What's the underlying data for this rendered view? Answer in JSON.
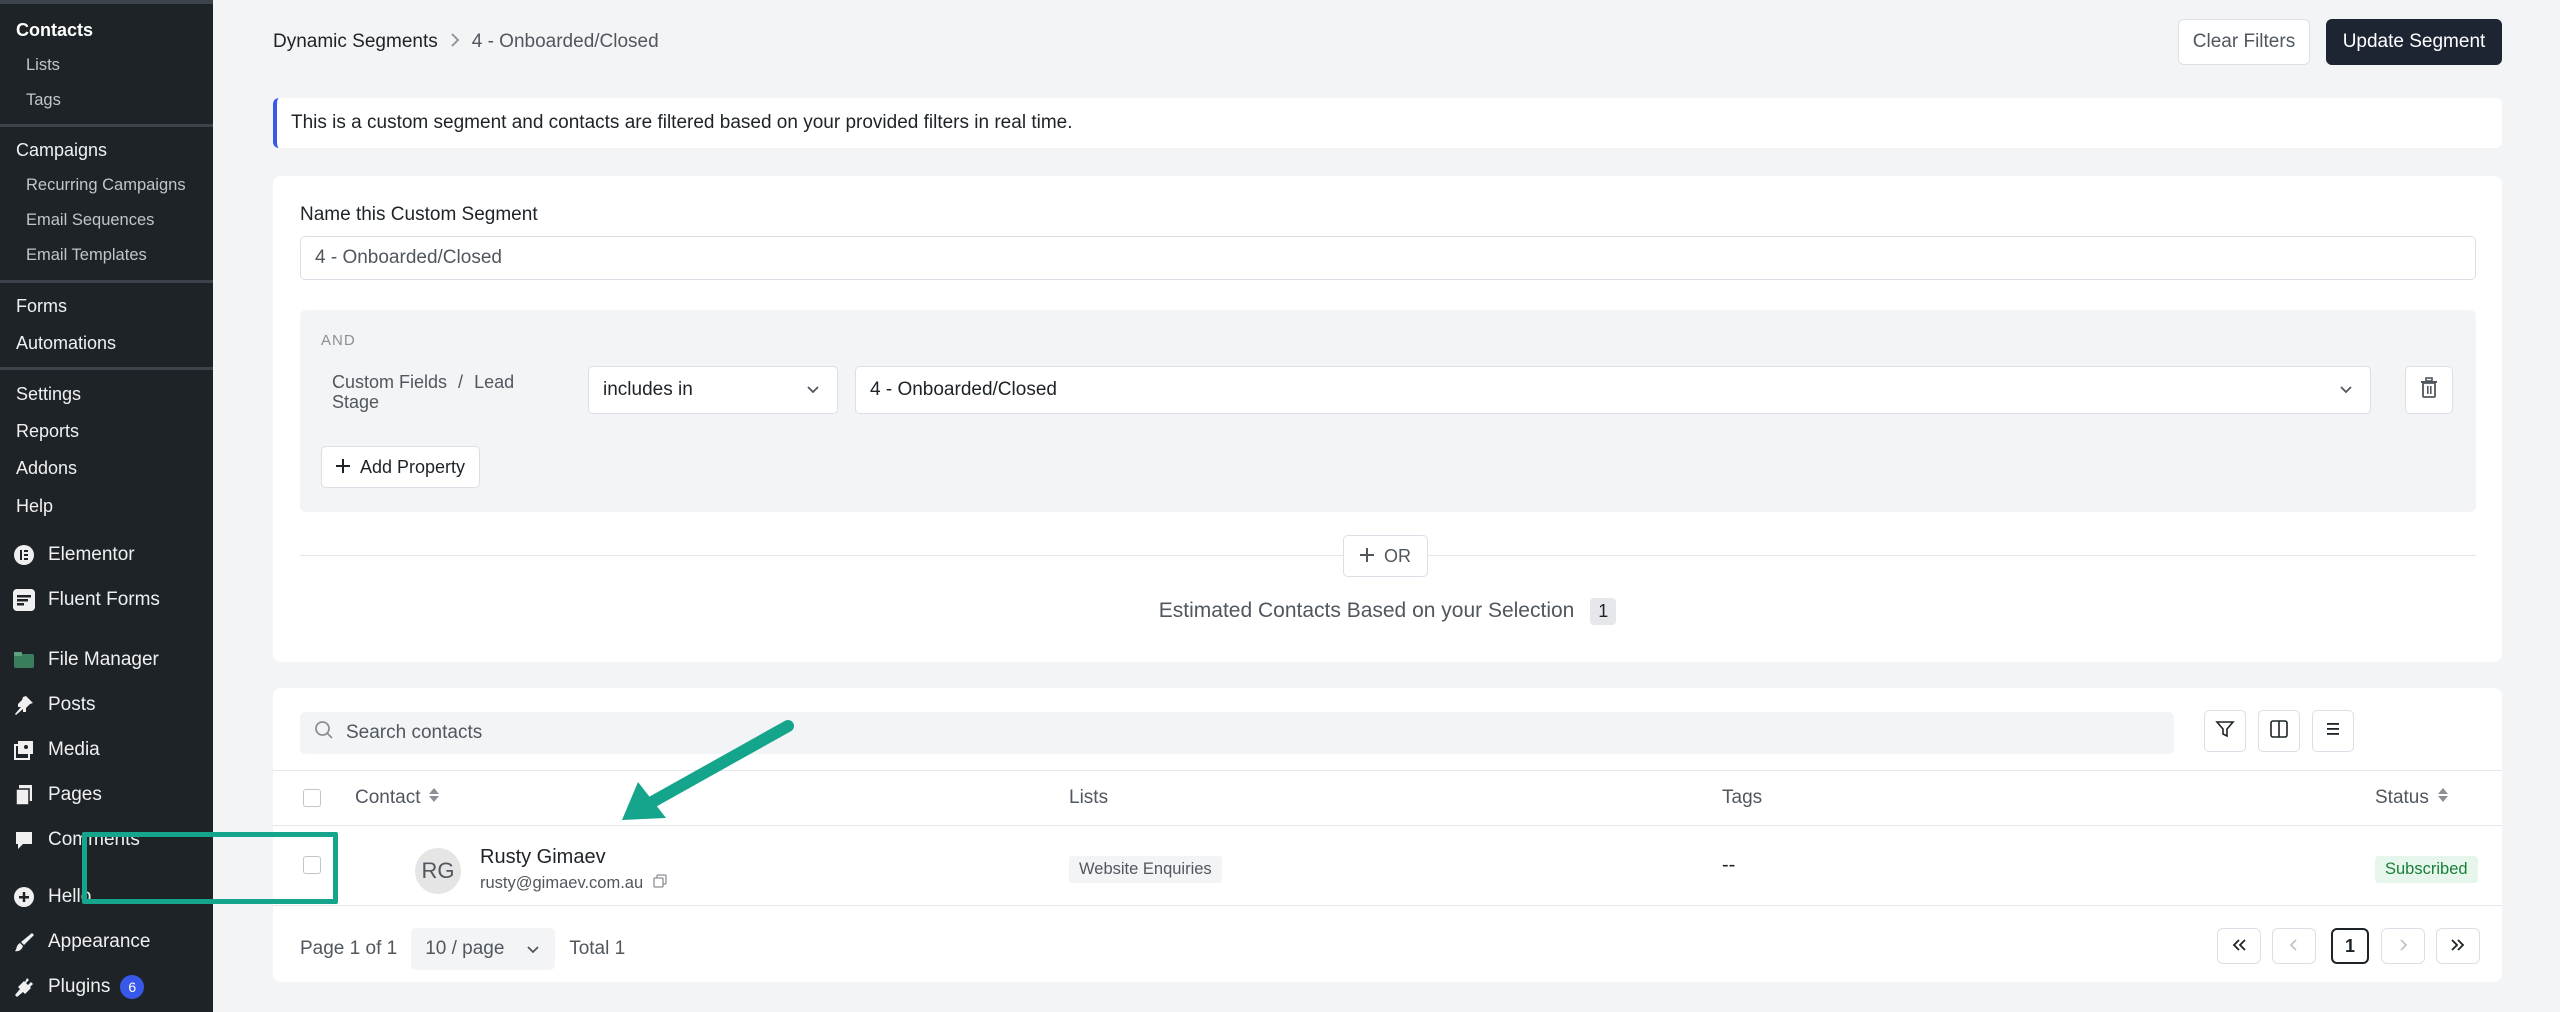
{
  "sidebar": {
    "contacts": "Contacts",
    "lists": "Lists",
    "tags": "Tags",
    "campaigns": "Campaigns",
    "recurring": "Recurring Campaigns",
    "sequences": "Email Sequences",
    "templates": "Email Templates",
    "forms": "Forms",
    "automations": "Automations",
    "settings": "Settings",
    "reports": "Reports",
    "addons": "Addons",
    "help": "Help",
    "main_items": [
      {
        "label": "Elementor",
        "icon": "elementor-icon"
      },
      {
        "label": "Fluent Forms",
        "icon": "fluent-forms-icon"
      },
      {
        "label": "File Manager",
        "icon": "file-manager-icon"
      },
      {
        "label": "Posts",
        "icon": "pin-icon"
      },
      {
        "label": "Media",
        "icon": "media-icon"
      },
      {
        "label": "Pages",
        "icon": "pages-icon"
      },
      {
        "label": "Comments",
        "icon": "comment-icon"
      },
      {
        "label": "Hello",
        "icon": "plus-circle-icon"
      },
      {
        "label": "Appearance",
        "icon": "brush-icon"
      },
      {
        "label": "Plugins",
        "icon": "plug-icon"
      }
    ],
    "plugins_badge": "6"
  },
  "header": {
    "breadcrumb_root": "Dynamic Segments",
    "breadcrumb_current": "4 - Onboarded/Closed",
    "clear_filters": "Clear Filters",
    "update_segment": "Update Segment"
  },
  "notice": "This is a custom segment and contacts are filtered based on your provided filters in real time.",
  "segment": {
    "name_label": "Name this Custom Segment",
    "name_value": "4 - Onboarded/Closed",
    "and_label": "AND",
    "field_path": "Custom Fields",
    "field_sep": "/",
    "field_name": "Lead Stage",
    "operator": "includes in",
    "value": "4 - Onboarded/Closed",
    "add_property": "Add Property",
    "or_label": "OR",
    "estimate_text": "Estimated Contacts Based on your Selection",
    "estimate_count": "1"
  },
  "contacts_table": {
    "search_placeholder": "Search contacts",
    "columns": {
      "contact": "Contact",
      "lists": "Lists",
      "tags": "Tags",
      "status": "Status"
    },
    "rows": [
      {
        "initials": "RG",
        "name": "Rusty Gimaev",
        "email": "rusty@gimaev.com.au",
        "list": "Website Enquiries",
        "tags": "--",
        "status": "Subscribed"
      }
    ],
    "page_info": "Page 1 of 1",
    "page_size": "10 / page",
    "total": "Total 1",
    "current_page": "1"
  },
  "colors": {
    "accent": "#3858e9",
    "highlight": "#14a58c",
    "dark_button": "#1e2532",
    "subscribed": "#1a7f37"
  }
}
